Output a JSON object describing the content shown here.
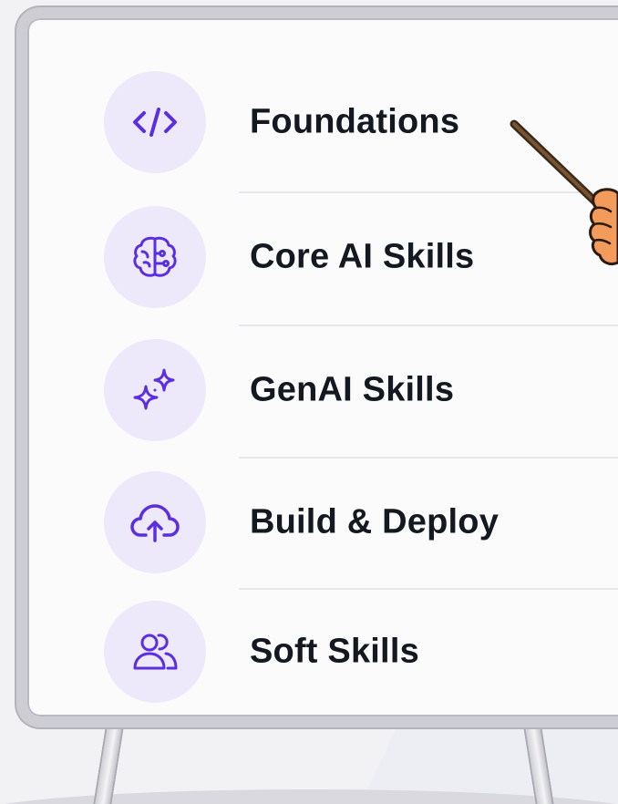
{
  "colors": {
    "accent": "#5b2ee0",
    "icon_bg": "#ede9fb",
    "text": "#141821",
    "board_frame": "#cdcdd3"
  },
  "menu": {
    "items": [
      {
        "label": "Foundations",
        "icon": "code-icon"
      },
      {
        "label": "Core AI Skills",
        "icon": "brain-icon"
      },
      {
        "label": "GenAI Skills",
        "icon": "sparkles-icon"
      },
      {
        "label": "Build & Deploy",
        "icon": "cloud-upload-icon"
      },
      {
        "label": "Soft Skills",
        "icon": "users-icon"
      }
    ]
  }
}
